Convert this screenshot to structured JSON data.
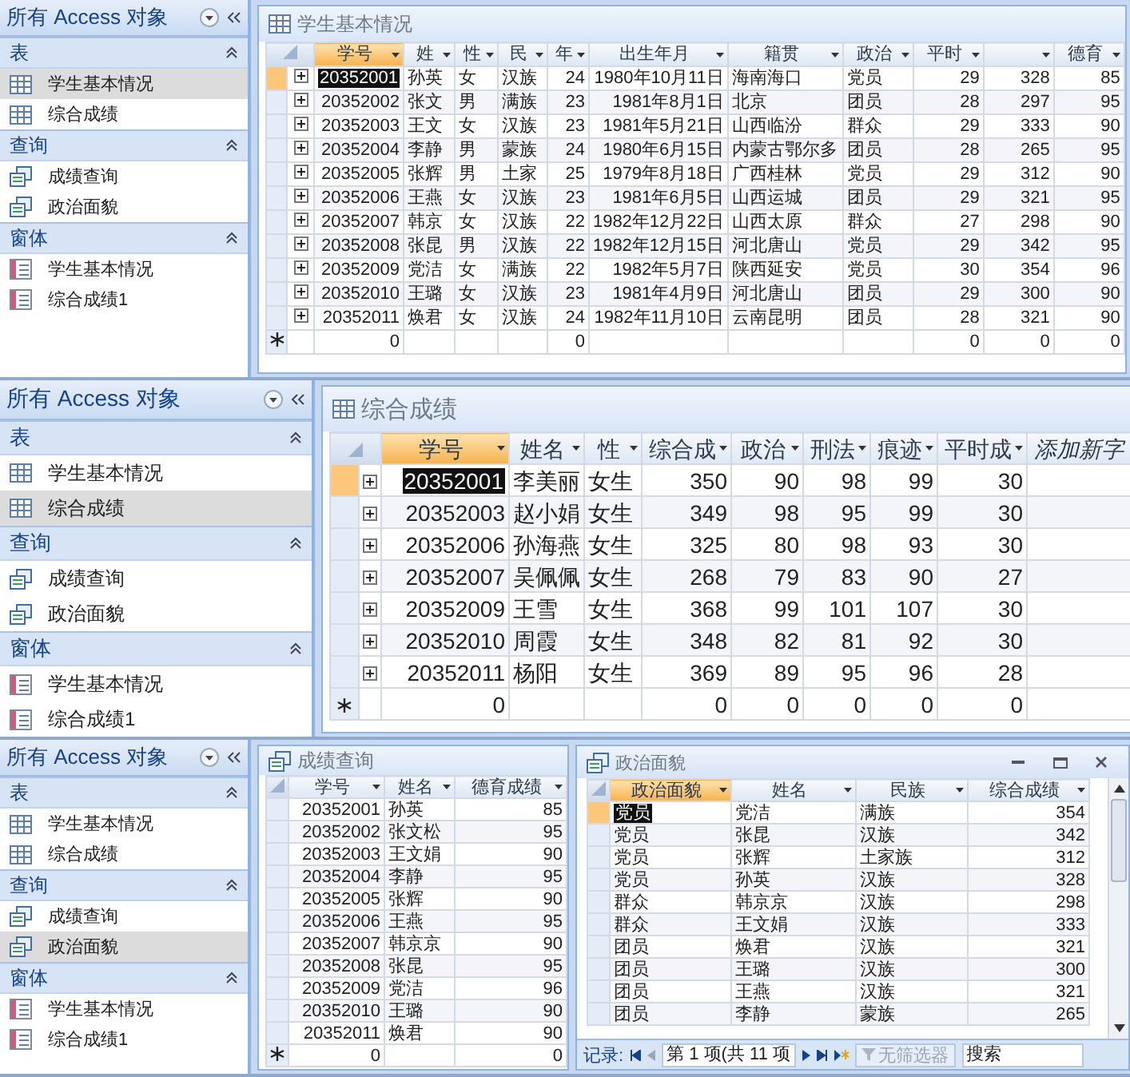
{
  "screens": [
    {
      "nav": {
        "title": "所有 Access 对象",
        "groups": [
          {
            "label": "表",
            "items": [
              {
                "label": "学生基本情况",
                "kind": "table",
                "selected": true
              },
              {
                "label": "综合成绩",
                "kind": "table",
                "selected": false
              }
            ]
          },
          {
            "label": "查询",
            "items": [
              {
                "label": "成绩查询",
                "kind": "query",
                "selected": false
              },
              {
                "label": "政治面貌",
                "kind": "query",
                "selected": false
              }
            ]
          },
          {
            "label": "窗体",
            "items": [
              {
                "label": "学生基本情况",
                "kind": "form",
                "selected": false
              },
              {
                "label": "综合成绩1",
                "kind": "form",
                "selected": false
              }
            ]
          }
        ]
      },
      "documents": [
        {
          "title": "学生基本情况",
          "kind": "table",
          "expandable": true,
          "columns": [
            {
              "label": "学号",
              "kind": "number",
              "selected": true
            },
            {
              "label": "姓",
              "kind": "text",
              "selected": false
            },
            {
              "label": "性",
              "kind": "text",
              "selected": false
            },
            {
              "label": "民",
              "kind": "text",
              "selected": false
            },
            {
              "label": "年",
              "kind": "number",
              "selected": false
            },
            {
              "label": "出生年月",
              "kind": "number",
              "selected": false
            },
            {
              "label": "籍贯",
              "kind": "text",
              "selected": false
            },
            {
              "label": "政治",
              "kind": "text",
              "selected": false
            },
            {
              "label": "平时",
              "kind": "number",
              "selected": false
            },
            {
              "kind": "number",
              "selected": false
            },
            {
              "label": "德育",
              "kind": "number",
              "selected": false
            }
          ],
          "rows": [
            {
              "selected": true,
              "cells": [
                "20352001",
                "孙英",
                "女",
                "汉族",
                "24",
                "1980年10月11日",
                "海南海口",
                "党员",
                "29",
                "328",
                "85"
              ]
            },
            {
              "selected": false,
              "cells": [
                "20352002",
                "张文",
                "男",
                "满族",
                "23",
                "1981年8月1日",
                "北京",
                "团员",
                "28",
                "297",
                "95"
              ]
            },
            {
              "selected": false,
              "cells": [
                "20352003",
                "王文",
                "女",
                "汉族",
                "23",
                "1981年5月21日",
                "山西临汾",
                "群众",
                "29",
                "333",
                "90"
              ]
            },
            {
              "selected": false,
              "cells": [
                "20352004",
                "李静",
                "男",
                "蒙族",
                "24",
                "1980年6月15日",
                "内蒙古鄂尔多",
                "团员",
                "28",
                "265",
                "95"
              ]
            },
            {
              "selected": false,
              "cells": [
                "20352005",
                "张辉",
                "男",
                "土家",
                "25",
                "1979年8月18日",
                "广西桂林",
                "党员",
                "29",
                "312",
                "90"
              ]
            },
            {
              "selected": false,
              "cells": [
                "20352006",
                "王燕",
                "女",
                "汉族",
                "23",
                "1981年6月5日",
                "山西运城",
                "团员",
                "29",
                "321",
                "95"
              ]
            },
            {
              "selected": false,
              "cells": [
                "20352007",
                "韩京",
                "女",
                "汉族",
                "22",
                "1982年12月22日",
                "山西太原",
                "群众",
                "27",
                "298",
                "90"
              ]
            },
            {
              "selected": false,
              "cells": [
                "20352008",
                "张昆",
                "男",
                "汉族",
                "22",
                "1982年12月15日",
                "河北唐山",
                "党员",
                "29",
                "342",
                "95"
              ]
            },
            {
              "selected": false,
              "cells": [
                "20352009",
                "党洁",
                "女",
                "满族",
                "22",
                "1982年5月7日",
                "陕西延安",
                "党员",
                "30",
                "354",
                "96"
              ]
            },
            {
              "selected": false,
              "cells": [
                "20352010",
                "王璐",
                "女",
                "汉族",
                "23",
                "1981年4月9日",
                "河北唐山",
                "团员",
                "29",
                "300",
                "90"
              ]
            },
            {
              "selected": false,
              "cells": [
                "20352011",
                "焕君",
                "女",
                "汉族",
                "24",
                "1982年11月10日",
                "云南昆明",
                "团员",
                "28",
                "321",
                "90"
              ]
            }
          ],
          "new_row": {
            "0": "0",
            "4": "0",
            "8": "0",
            "9": "0",
            "10": "0"
          }
        }
      ]
    },
    {
      "nav": {
        "title": "所有 Access 对象",
        "groups": [
          {
            "label": "表",
            "items": [
              {
                "label": "学生基本情况",
                "kind": "table",
                "selected": false
              },
              {
                "label": "综合成绩",
                "kind": "table",
                "selected": true
              }
            ]
          },
          {
            "label": "查询",
            "items": [
              {
                "label": "成绩查询",
                "kind": "query",
                "selected": false
              },
              {
                "label": "政治面貌",
                "kind": "query",
                "selected": false
              }
            ]
          },
          {
            "label": "窗体",
            "items": [
              {
                "label": "学生基本情况",
                "kind": "form",
                "selected": false
              },
              {
                "label": "综合成绩1",
                "kind": "form",
                "selected": false
              }
            ]
          }
        ]
      },
      "documents": [
        {
          "title": "综合成绩",
          "kind": "table",
          "expandable": true,
          "columns": [
            {
              "label": "学号",
              "kind": "number",
              "selected": true
            },
            {
              "label": "姓名",
              "kind": "text",
              "selected": false
            },
            {
              "label": "性",
              "kind": "text",
              "selected": false
            },
            {
              "label": "综合成",
              "kind": "number",
              "selected": false
            },
            {
              "label": "政治",
              "kind": "number",
              "selected": false
            },
            {
              "label": "刑法",
              "kind": "number",
              "selected": false
            },
            {
              "label": "痕迹",
              "kind": "number",
              "selected": false
            },
            {
              "label": "平时成",
              "kind": "number",
              "selected": false
            },
            {
              "label": "添加新字",
              "kind": "add",
              "selected": false
            }
          ],
          "rows": [
            {
              "selected": true,
              "cells": [
                "20352001",
                "李美丽",
                "女生",
                "350",
                "90",
                "98",
                "99",
                "30"
              ]
            },
            {
              "selected": false,
              "cells": [
                "20352003",
                "赵小娟",
                "女生",
                "349",
                "98",
                "95",
                "99",
                "30"
              ]
            },
            {
              "selected": false,
              "cells": [
                "20352006",
                "孙海燕",
                "女生",
                "325",
                "80",
                "98",
                "93",
                "30"
              ]
            },
            {
              "selected": false,
              "cells": [
                "20352007",
                "吴佩佩",
                "女生",
                "268",
                "79",
                "83",
                "90",
                "27"
              ]
            },
            {
              "selected": false,
              "cells": [
                "20352009",
                "王雪",
                "女生",
                "368",
                "99",
                "101",
                "107",
                "30"
              ]
            },
            {
              "selected": false,
              "cells": [
                "20352010",
                "周霞",
                "女生",
                "348",
                "82",
                "81",
                "92",
                "30"
              ]
            },
            {
              "selected": false,
              "cells": [
                "20352011",
                "杨阳",
                "女生",
                "369",
                "89",
                "95",
                "96",
                "28"
              ]
            }
          ],
          "new_row": {
            "0": "0",
            "3": "0",
            "4": "0",
            "5": "0",
            "6": "0",
            "7": "0"
          }
        }
      ]
    },
    {
      "nav": {
        "title": "所有 Access 对象",
        "groups": [
          {
            "label": "表",
            "items": [
              {
                "label": "学生基本情况",
                "kind": "table",
                "selected": false
              },
              {
                "label": "综合成绩",
                "kind": "table",
                "selected": false
              }
            ]
          },
          {
            "label": "查询",
            "items": [
              {
                "label": "成绩查询",
                "kind": "query",
                "selected": false
              },
              {
                "label": "政治面貌",
                "kind": "query",
                "selected": true
              }
            ]
          },
          {
            "label": "窗体",
            "items": [
              {
                "label": "学生基本情况",
                "kind": "form",
                "selected": false
              },
              {
                "label": "综合成绩1",
                "kind": "form",
                "selected": false
              }
            ]
          }
        ]
      },
      "documents": [
        {
          "title": "成绩查询",
          "kind": "query",
          "columns": [
            {
              "label": "学号",
              "kind": "number",
              "selected": false
            },
            {
              "label": "姓名",
              "kind": "text",
              "selected": false
            },
            {
              "label": "德育成绩",
              "kind": "number",
              "selected": false
            }
          ],
          "rows": [
            {
              "selected": false,
              "cells": [
                "20352001",
                "孙英",
                "85"
              ]
            },
            {
              "selected": false,
              "cells": [
                "20352002",
                "张文松",
                "95"
              ]
            },
            {
              "selected": false,
              "cells": [
                "20352003",
                "王文娟",
                "90"
              ]
            },
            {
              "selected": false,
              "cells": [
                "20352004",
                "李静",
                "95"
              ]
            },
            {
              "selected": false,
              "cells": [
                "20352005",
                "张辉",
                "90"
              ]
            },
            {
              "selected": false,
              "cells": [
                "20352006",
                "王燕",
                "95"
              ]
            },
            {
              "selected": false,
              "cells": [
                "20352007",
                "韩京京",
                "90"
              ]
            },
            {
              "selected": false,
              "cells": [
                "20352008",
                "张昆",
                "95"
              ]
            },
            {
              "selected": false,
              "cells": [
                "20352009",
                "党洁",
                "96"
              ]
            },
            {
              "selected": false,
              "cells": [
                "20352010",
                "王璐",
                "90"
              ]
            },
            {
              "selected": false,
              "cells": [
                "20352011",
                "焕君",
                "90"
              ]
            }
          ],
          "new_row": {
            "0": "0",
            "2": "0"
          }
        }
      ],
      "windows": [
        {
          "title": "政治面貌",
          "kind": "query",
          "columns": [
            {
              "label": "政治面貌",
              "kind": "text",
              "selected": true
            },
            {
              "label": "姓名",
              "kind": "text",
              "selected": false
            },
            {
              "label": "民族",
              "kind": "text",
              "selected": false
            },
            {
              "label": "综合成绩",
              "kind": "number",
              "selected": false
            }
          ],
          "rows": [
            {
              "selected": true,
              "cells": [
                "党员",
                "党洁",
                "满族",
                "354"
              ]
            },
            {
              "selected": false,
              "cells": [
                "党员",
                "张昆",
                "汉族",
                "342"
              ]
            },
            {
              "selected": false,
              "cells": [
                "党员",
                "张辉",
                "土家族",
                "312"
              ]
            },
            {
              "selected": false,
              "cells": [
                "党员",
                "孙英",
                "汉族",
                "328"
              ]
            },
            {
              "selected": false,
              "cells": [
                "群众",
                "韩京京",
                "汉族",
                "298"
              ]
            },
            {
              "selected": false,
              "cells": [
                "群众",
                "王文娟",
                "汉族",
                "333"
              ]
            },
            {
              "selected": false,
              "cells": [
                "团员",
                "焕君",
                "汉族",
                "321"
              ]
            },
            {
              "selected": false,
              "cells": [
                "团员",
                "王璐",
                "汉族",
                "300"
              ]
            },
            {
              "selected": false,
              "cells": [
                "团员",
                "王燕",
                "汉族",
                "321"
              ]
            },
            {
              "selected": false,
              "cells": [
                "团员",
                "李静",
                "蒙族",
                "265"
              ]
            }
          ],
          "record_bar": {
            "label": "记录:",
            "position": "第 1 项(共 11 项",
            "filter": {
              "label": "无筛选器",
              "disabled": true
            },
            "search": {
              "placeholder": "搜索"
            }
          }
        }
      ]
    }
  ]
}
